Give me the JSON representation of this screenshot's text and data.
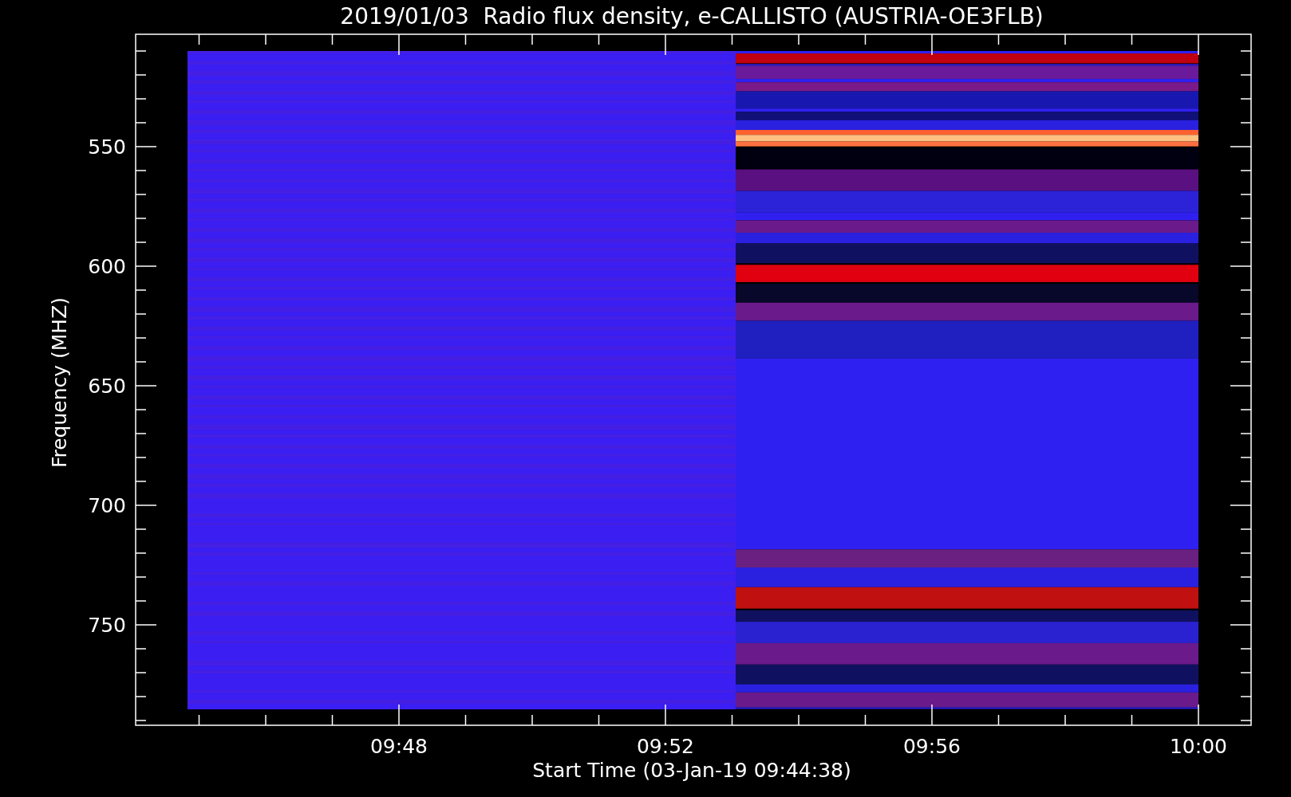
{
  "title": "2019/01/03  Radio flux density, e-CALLISTO (AUSTRIA-OE3FLB)",
  "y_axis": {
    "label": "Frequency (MHZ)",
    "ticks": [
      "550",
      "600",
      "650",
      "700",
      "750"
    ]
  },
  "x_axis": {
    "label": "Start Time (03-Jan-19 09:44:38)",
    "ticks": [
      "09:48",
      "09:52",
      "09:56",
      "10:00"
    ]
  }
}
